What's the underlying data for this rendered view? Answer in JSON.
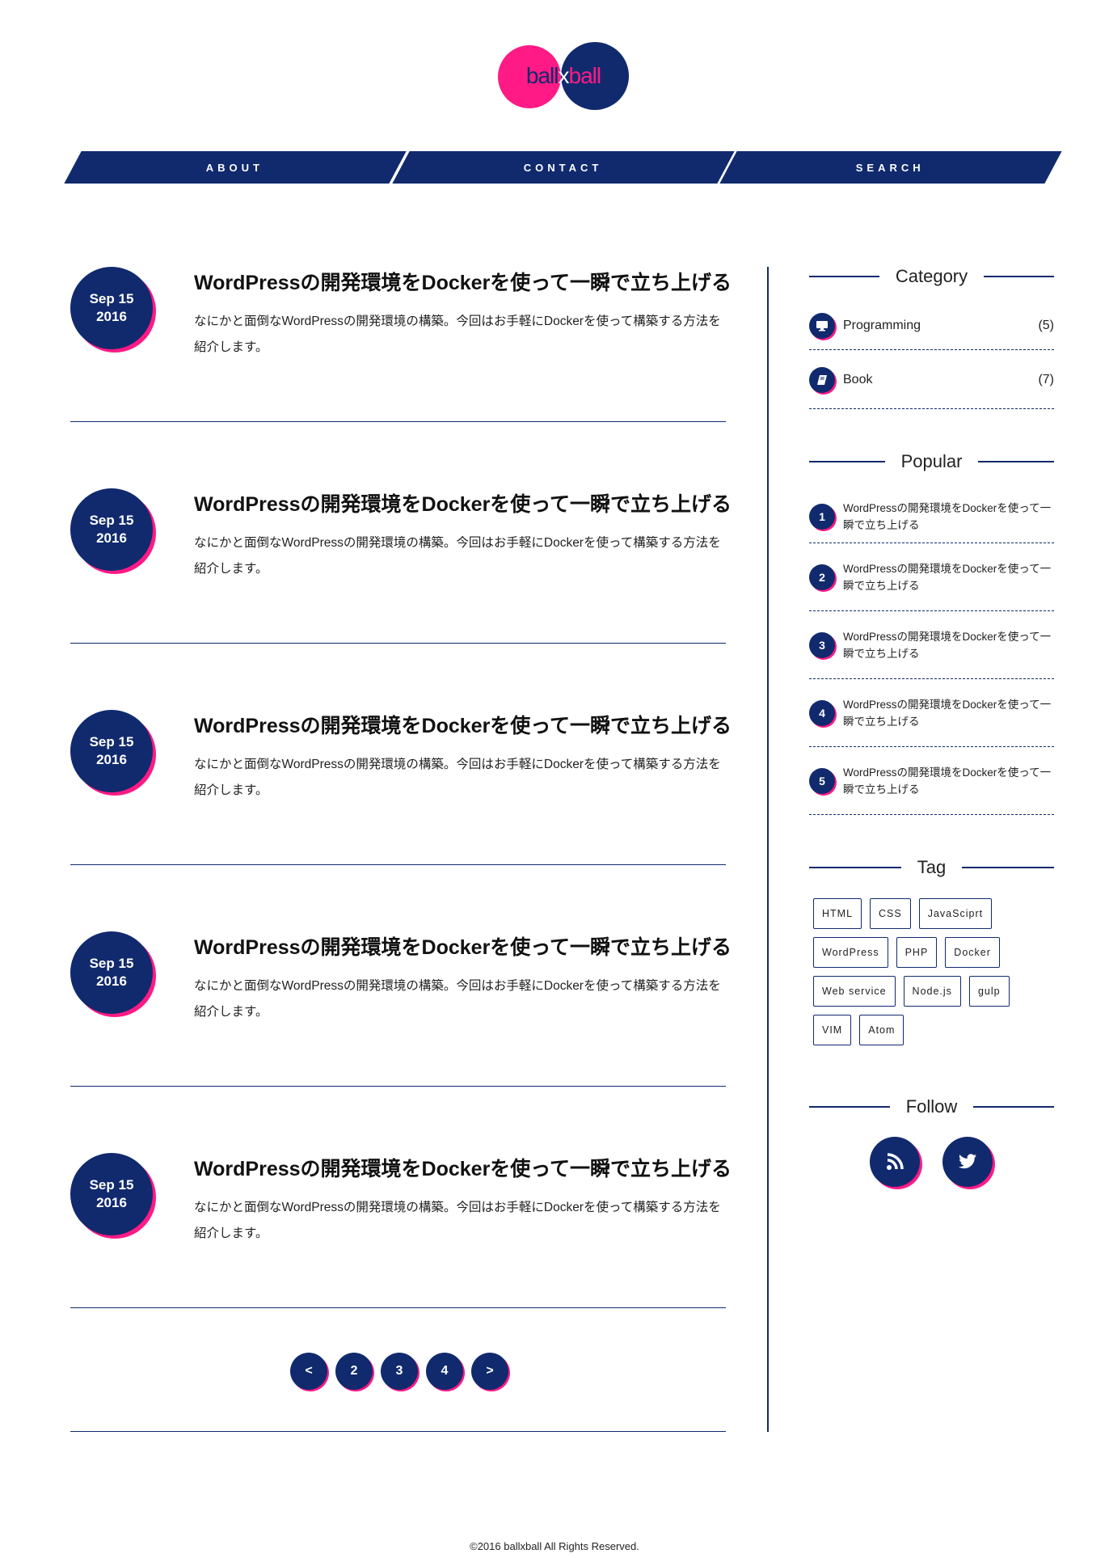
{
  "logo": {
    "left": "ball",
    "mid": "x",
    "right": "ball"
  },
  "nav": [
    {
      "label": "ABOUT"
    },
    {
      "label": "CONTACT"
    },
    {
      "label": "SEARCH"
    }
  ],
  "posts": [
    {
      "month": "Sep 15",
      "year": "2016",
      "title": "WordPressの開発環境をDockerを使って一瞬で立ち上げる",
      "excerpt": "なにかと面倒なWordPressの開発環境の構築。今回はお手軽にDockerを使って構築する方法を紹介します。"
    },
    {
      "month": "Sep 15",
      "year": "2016",
      "title": "WordPressの開発環境をDockerを使って一瞬で立ち上げる",
      "excerpt": "なにかと面倒なWordPressの開発環境の構築。今回はお手軽にDockerを使って構築する方法を紹介します。"
    },
    {
      "month": "Sep 15",
      "year": "2016",
      "title": "WordPressの開発環境をDockerを使って一瞬で立ち上げる",
      "excerpt": "なにかと面倒なWordPressの開発環境の構築。今回はお手軽にDockerを使って構築する方法を紹介します。"
    },
    {
      "month": "Sep 15",
      "year": "2016",
      "title": "WordPressの開発環境をDockerを使って一瞬で立ち上げる",
      "excerpt": "なにかと面倒なWordPressの開発環境の構築。今回はお手軽にDockerを使って構築する方法を紹介します。"
    },
    {
      "month": "Sep 15",
      "year": "2016",
      "title": "WordPressの開発環境をDockerを使って一瞬で立ち上げる",
      "excerpt": "なにかと面倒なWordPressの開発環境の構築。今回はお手軽にDockerを使って構築する方法を紹介します。"
    }
  ],
  "pagination": [
    "<",
    "2",
    "3",
    "4",
    ">"
  ],
  "sidebar": {
    "category": {
      "title": "Category",
      "items": [
        {
          "label": "Programming",
          "count": "(5)",
          "icon": "monitor-icon"
        },
        {
          "label": "Book",
          "count": "(7)",
          "icon": "book-icon"
        }
      ]
    },
    "popular": {
      "title": "Popular",
      "items": [
        {
          "rank": "1",
          "title": "WordPressの開発環境をDockerを使って一瞬で立ち上げる"
        },
        {
          "rank": "2",
          "title": "WordPressの開発環境をDockerを使って一瞬で立ち上げる"
        },
        {
          "rank": "3",
          "title": "WordPressの開発環境をDockerを使って一瞬で立ち上げる"
        },
        {
          "rank": "4",
          "title": "WordPressの開発環境をDockerを使って一瞬で立ち上げる"
        },
        {
          "rank": "5",
          "title": "WordPressの開発環境をDockerを使って一瞬で立ち上げる"
        }
      ]
    },
    "tag": {
      "title": "Tag",
      "items": [
        "HTML",
        "CSS",
        "JavaSciprt",
        "WordPress",
        "PHP",
        "Docker",
        "Web service",
        "Node.js",
        "gulp",
        "VIM",
        "Atom"
      ]
    },
    "follow": {
      "title": "Follow",
      "icons": [
        "rss-icon",
        "twitter-icon"
      ]
    }
  },
  "footer": "©2016 ballxball All Rights Reserved.",
  "colors": {
    "navy": "#112a6e",
    "pink": "#ff1a85"
  }
}
